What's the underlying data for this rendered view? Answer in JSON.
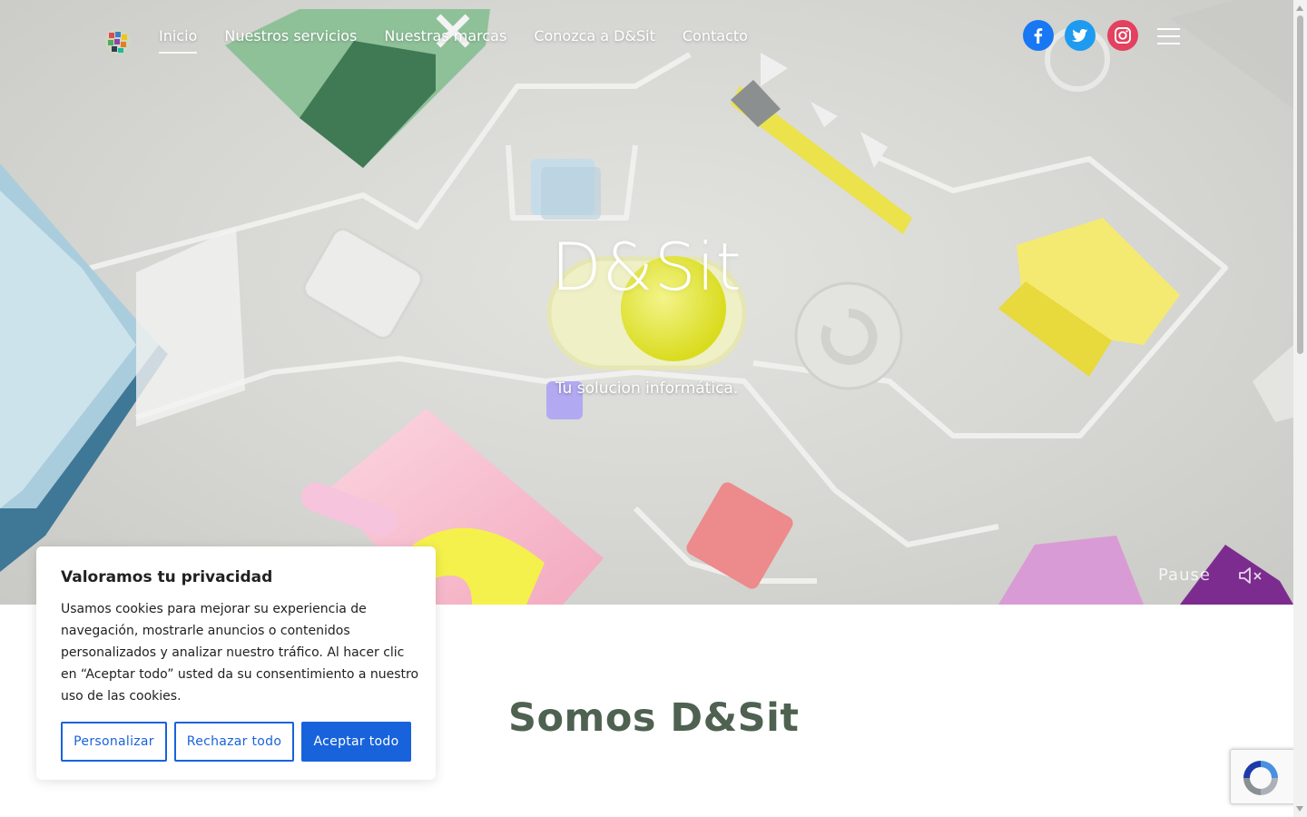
{
  "nav": {
    "links": [
      {
        "label": "Inicio",
        "active": true
      },
      {
        "label": "Nuestros servicios",
        "active": false
      },
      {
        "label": "Nuestras marcas",
        "active": false
      },
      {
        "label": "Conozca a D&Sit",
        "active": false
      },
      {
        "label": "Contacto",
        "active": false
      }
    ],
    "social": [
      {
        "icon": "facebook-icon",
        "color": "#1877f2"
      },
      {
        "icon": "twitter-icon",
        "color": "#1d9bf0"
      },
      {
        "icon": "instagram-icon",
        "color": "#e4405f"
      }
    ],
    "menu_icon": "hamburger-menu-icon"
  },
  "hero": {
    "title": "D&Sit",
    "subtitle": "Tu solucion informática.",
    "pause_label": "Pause",
    "mute_icon": "speaker-muted-icon"
  },
  "section": {
    "title": "Somos D&Sit",
    "title_color": "#4f6150"
  },
  "cookie": {
    "title": "Valoramos tu privacidad",
    "text": "Usamos cookies para mejorar su experiencia de navegación, mostrarle anuncios o contenidos personalizados y analizar nuestro tráfico. Al hacer clic en “Aceptar todo” usted da su consentimiento a nuestro uso de las cookies.",
    "buttons": {
      "customize": "Personalizar",
      "reject": "Rechazar todo",
      "accept": "Aceptar todo"
    },
    "accent_color": "#1863dc"
  },
  "recaptcha": {
    "icon": "recaptcha-icon"
  }
}
